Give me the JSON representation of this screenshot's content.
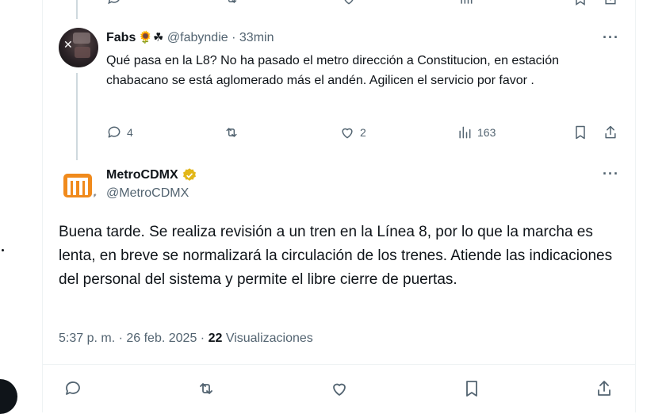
{
  "reply_tweet": {
    "name": "Fabs",
    "emojis": "🌻☘",
    "handle": "@fabyndie",
    "separator": "·",
    "time": "33min",
    "text": "Qué pasa en la L8? No ha pasado el metro dirección a Constitucion, en estación chabacano se está aglomerado más el andén. Agilicen el servicio por favor .",
    "more_label": "···",
    "replies": "4",
    "retweets": "",
    "likes": "2",
    "views": "163"
  },
  "main_tweet": {
    "name": "MetroCDMX",
    "handle": "@MetroCDMX",
    "text": "Buena tarde. Se realiza revisión a un tren en la Línea 8, por lo que la marcha es lenta, en breve se normalizará la circulación de los trenes. Atiende las indicaciones del personal del sistema y permite el libre cierre de puertas.",
    "more_label": "···",
    "timestamp": "5:37 p. m. · 26 feb. 2025 ·",
    "views_count": "22",
    "views_label": "Visualizaciones"
  },
  "colors": {
    "text_primary": "#0f1419",
    "text_secondary": "#536471",
    "border": "#eff3f4",
    "thread_line": "#cfd9de",
    "verified_gold": "#e2b719",
    "metro_orange": "#f08a1c"
  },
  "icons": [
    "reply-icon",
    "retweet-icon",
    "like-icon",
    "views-icon",
    "bookmark-icon",
    "share-icon",
    "more-icon",
    "verified-badge-icon",
    "metro-logo"
  ]
}
